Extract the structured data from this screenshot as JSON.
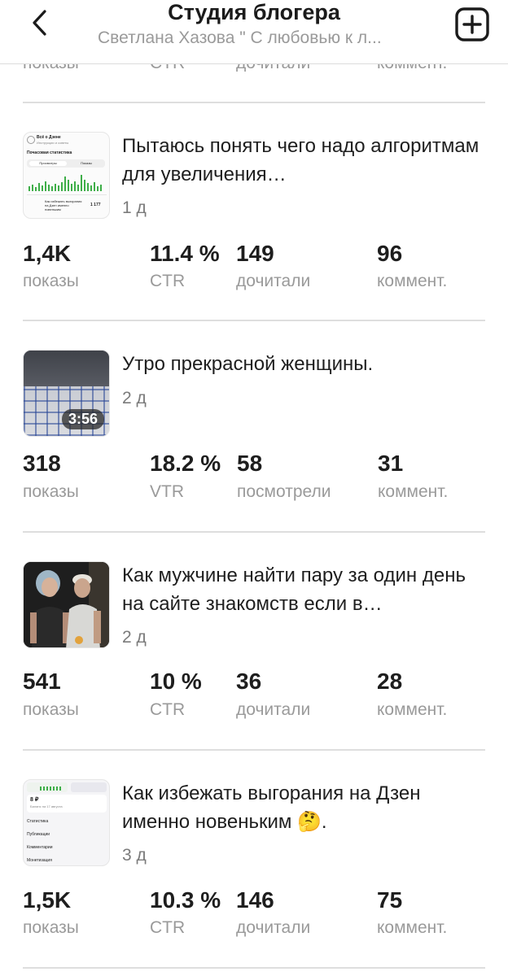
{
  "header": {
    "title": "Студия блогера",
    "subtitle": "Светлана Хазова \" С любовью к л..."
  },
  "top_clipped_labels": [
    "показы",
    "CTR",
    "дочитали",
    "коммент."
  ],
  "posts": [
    {
      "title": "Пытаюсь понять чего надо алгоритмам для увеличения…",
      "age": "1 д",
      "stats": [
        {
          "value": "1,4K",
          "label": "показы"
        },
        {
          "value": "11.4 %",
          "label": "CTR"
        },
        {
          "value": "149",
          "label": "дочитали"
        },
        {
          "value": "96",
          "label": "коммент."
        }
      ],
      "thumb": {
        "line1": "Всё о Дзене",
        "line2": "Инструкции и советы",
        "line3": "Почасовая статистика",
        "tab1": "Просмотры",
        "tab2": "Показы",
        "line4": "Как избежать выгорания на Дзен именно новеньким",
        "number": "1 177"
      }
    },
    {
      "title": "Утро прекрасной женщины.",
      "age": "2 д",
      "duration": "3:56",
      "stats": [
        {
          "value": "318",
          "label": "показы"
        },
        {
          "value": "18.2 %",
          "label": "VTR"
        },
        {
          "value": "58",
          "label": "посмотрели"
        },
        {
          "value": "31",
          "label": "коммент."
        }
      ]
    },
    {
      "title": "Как мужчине найти пару за один день на сайте знакомств если в…",
      "age": "2 д",
      "stats": [
        {
          "value": "541",
          "label": "показы"
        },
        {
          "value": "10 %",
          "label": "CTR"
        },
        {
          "value": "36",
          "label": "дочитали"
        },
        {
          "value": "28",
          "label": "коммент."
        }
      ]
    },
    {
      "title": "Как избежать выгорания на Дзен именно новеньким 🤔.",
      "age": "3 д",
      "stats": [
        {
          "value": "1,5K",
          "label": "показы"
        },
        {
          "value": "10.3 %",
          "label": "CTR"
        },
        {
          "value": "146",
          "label": "дочитали"
        },
        {
          "value": "75",
          "label": "коммент."
        }
      ],
      "thumb": {
        "balance": "8 ₽",
        "balance_note": "Баланс на 17 августа",
        "menu": [
          "Статистика",
          "Публикации",
          "Комментарии",
          "Монетизация"
        ]
      }
    }
  ]
}
